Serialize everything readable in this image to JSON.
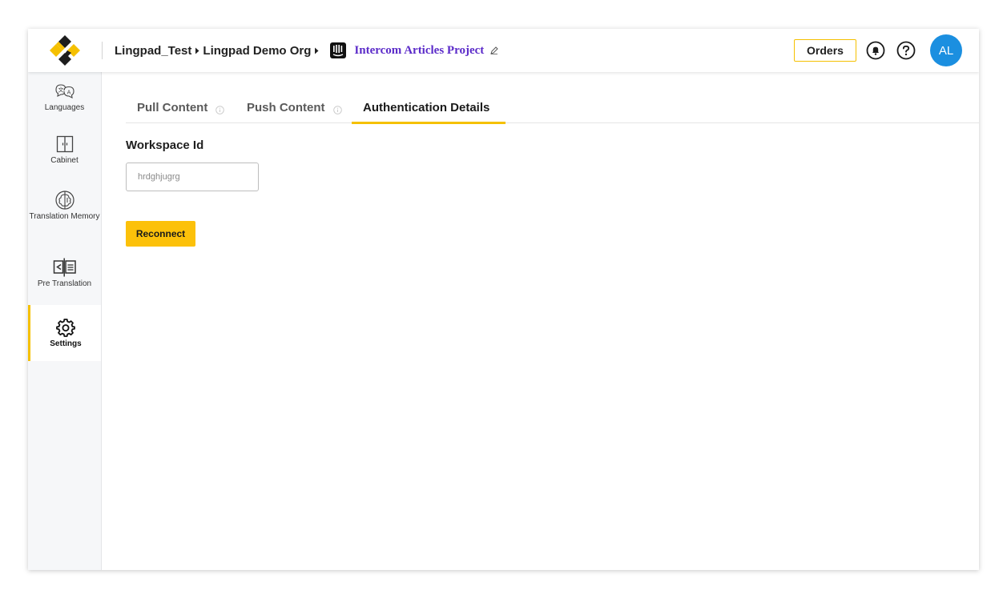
{
  "header": {
    "breadcrumb": {
      "org_root": "Lingpad_Test",
      "organization": "Lingpad Demo Org",
      "project": "Intercom Articles Project"
    },
    "orders_label": "Orders",
    "avatar_initials": "AL",
    "icons": [
      "logo-icon",
      "chevron-right-icon",
      "intercom-icon",
      "pencil-edit-icon",
      "notification-bell-icon",
      "help-question-icon"
    ]
  },
  "sidebar": {
    "items": [
      {
        "label": "Languages",
        "icon": "languages-icon"
      },
      {
        "label": "Cabinet",
        "icon": "cabinet-icon"
      },
      {
        "label": "Translation Memory",
        "icon": "translation-memory-icon"
      },
      {
        "label": "Pre Translation",
        "icon": "pre-translation-icon"
      },
      {
        "label": "Settings",
        "icon": "gear-icon",
        "active": true
      }
    ]
  },
  "main": {
    "tabs": [
      {
        "label": "Pull Content",
        "active": false
      },
      {
        "label": "Push Content",
        "active": false
      },
      {
        "label": "Authentication Details",
        "active": true
      }
    ],
    "workspace": {
      "label": "Workspace Id",
      "value": "hrdghjugrg"
    },
    "reconnect_label": "Reconnect"
  },
  "colors": {
    "accent": "#f5c000",
    "project_link": "#5b2bc9",
    "avatar_bg": "#1b8fe0",
    "button_bg": "#fcc10a"
  }
}
